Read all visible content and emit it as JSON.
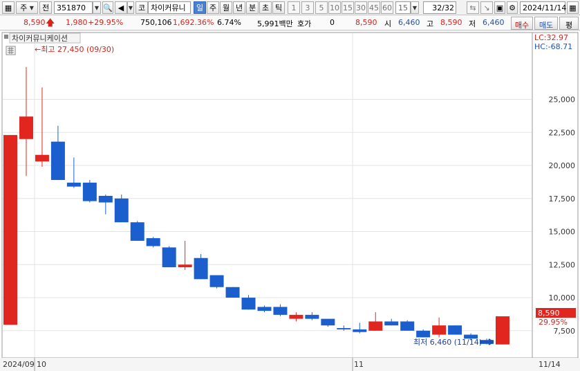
{
  "toolbar": {
    "market_label": "주",
    "prev_label": "전",
    "code_value": "351870",
    "stock_type_label": "코",
    "stock_name": "차이커뮤니",
    "periods": [
      "일",
      "주",
      "월",
      "년",
      "분",
      "초",
      "틱"
    ],
    "active_period": "일",
    "intervals": [
      "1",
      "3",
      "5",
      "10",
      "15",
      "30",
      "45",
      "60"
    ],
    "interval_value": "15",
    "page_value": "32",
    "page_total": "/32",
    "date_value": "2024/11/14"
  },
  "quote": {
    "price": "8,590",
    "change": "1,980",
    "change_pct": "+29.95%",
    "volume": "750,106",
    "volume_pct": "1,692.36%",
    "turnover": "6.74%",
    "amount": "5,991백만",
    "hoga_label": "호가",
    "hoga_value": "0",
    "ask_value": "8,590",
    "open_label": "시",
    "open_value": "6,460",
    "high_label": "고",
    "high_value": "8,590",
    "low_label": "저",
    "low_value": "6,460",
    "buy_label": "매수",
    "sell_label": "매도",
    "eval_label": "평"
  },
  "chart": {
    "legend_name": "차이커뮤니케이션",
    "lc_label": "LC:32.97",
    "hc_label": "HC:-68.71",
    "max_annotation": "←최고 27,450 (09/30)",
    "min_annotation": "최저 6,460 (11/14)",
    "current_price_label": "8,590",
    "current_pct_label": "29.95%",
    "x_labels": [
      "2024/09",
      "10",
      "11",
      "11/14"
    ],
    "colors": {
      "up": "#e0261f",
      "down": "#1b5fcf"
    }
  },
  "chart_data": {
    "type": "candlestick",
    "ylim": [
      5500,
      30000
    ],
    "y_ticks": [
      7500,
      10000,
      12500,
      15000,
      17500,
      20000,
      22500,
      25000
    ],
    "y_tick_labels": [
      "7,500",
      "10,000",
      "12,500",
      "15,000",
      "17,500",
      "20,000",
      "22,500",
      "25,000"
    ],
    "candles": [
      {
        "open": 7950,
        "high": 22200,
        "low": 13500,
        "close": 22300
      },
      {
        "open": 22000,
        "high": 27450,
        "low": 19200,
        "close": 23700
      },
      {
        "open": 20300,
        "high": 25900,
        "low": 19900,
        "close": 20800
      },
      {
        "open": 21800,
        "high": 23000,
        "low": 18900,
        "close": 18900
      },
      {
        "open": 18700,
        "high": 20600,
        "low": 18300,
        "close": 18400
      },
      {
        "open": 18700,
        "high": 18900,
        "low": 17200,
        "close": 17300
      },
      {
        "open": 17700,
        "high": 17800,
        "low": 16300,
        "close": 17200
      },
      {
        "open": 17500,
        "high": 17800,
        "low": 15700,
        "close": 15700
      },
      {
        "open": 15700,
        "high": 15800,
        "low": 14300,
        "close": 14300
      },
      {
        "open": 14500,
        "high": 14600,
        "low": 13800,
        "close": 13900
      },
      {
        "open": 13800,
        "high": 13900,
        "low": 12300,
        "close": 12300
      },
      {
        "open": 12300,
        "high": 14300,
        "low": 12100,
        "close": 12500
      },
      {
        "open": 13000,
        "high": 13300,
        "low": 11400,
        "close": 11400
      },
      {
        "open": 11700,
        "high": 11700,
        "low": 10700,
        "close": 10800
      },
      {
        "open": 10800,
        "high": 10800,
        "low": 10000,
        "close": 10000
      },
      {
        "open": 10000,
        "high": 10200,
        "low": 9100,
        "close": 9100
      },
      {
        "open": 9300,
        "high": 9400,
        "low": 8900,
        "close": 9000
      },
      {
        "open": 9300,
        "high": 9500,
        "low": 8600,
        "close": 8700
      },
      {
        "open": 8400,
        "high": 8900,
        "low": 8200,
        "close": 8700
      },
      {
        "open": 8700,
        "high": 8900,
        "low": 8300,
        "close": 8400
      },
      {
        "open": 8400,
        "high": 8400,
        "low": 7800,
        "close": 7900
      },
      {
        "open": 7700,
        "high": 7900,
        "low": 7500,
        "close": 7600
      },
      {
        "open": 7600,
        "high": 8100,
        "low": 7300,
        "close": 7400
      },
      {
        "open": 7500,
        "high": 8900,
        "low": 7500,
        "close": 8200
      },
      {
        "open": 8200,
        "high": 8400,
        "low": 7900,
        "close": 7900
      },
      {
        "open": 8200,
        "high": 8300,
        "low": 7500,
        "close": 7500
      },
      {
        "open": 7500,
        "high": 7600,
        "low": 7000,
        "close": 7000
      },
      {
        "open": 7200,
        "high": 8500,
        "low": 7000,
        "close": 7900
      },
      {
        "open": 7900,
        "high": 7900,
        "low": 7200,
        "close": 7200
      },
      {
        "open": 7200,
        "high": 7300,
        "low": 6800,
        "close": 6900
      },
      {
        "open": 6800,
        "high": 6900,
        "low": 6460,
        "close": 6500
      },
      {
        "open": 6460,
        "high": 8590,
        "low": 6460,
        "close": 8590
      }
    ]
  }
}
